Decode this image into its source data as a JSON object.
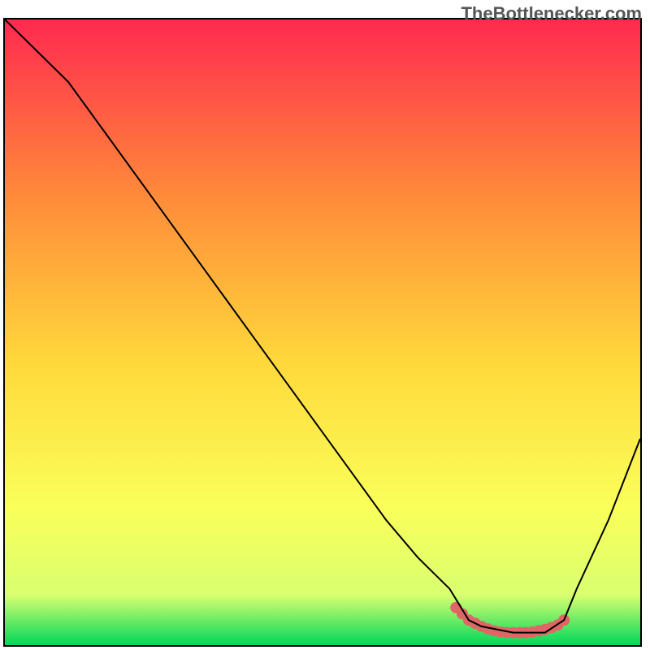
{
  "watermark": "TheBottlenecker.com",
  "chart_data": {
    "type": "line",
    "title": "",
    "xlabel": "",
    "ylabel": "",
    "xlim": [
      0,
      100
    ],
    "ylim": [
      0,
      100
    ],
    "grid": false,
    "legend": false,
    "series": [
      {
        "name": "main-curve",
        "color": "#000000",
        "x": [
          0,
          5,
          10,
          15,
          20,
          25,
          30,
          35,
          40,
          45,
          50,
          55,
          60,
          65,
          70,
          73,
          75,
          80,
          85,
          88,
          90,
          95,
          100
        ],
        "y": [
          100,
          95,
          90,
          83,
          76,
          69,
          62,
          55,
          48,
          41,
          34,
          27,
          20,
          14,
          9,
          4,
          3,
          2,
          2,
          4,
          9,
          20,
          33
        ]
      },
      {
        "name": "highlight-dots",
        "color": "#e06666",
        "kind": "scatter",
        "x": [
          71,
          72,
          73,
          74,
          75,
          76,
          77,
          78,
          79,
          80,
          81,
          82,
          83,
          84,
          85,
          86,
          87,
          88
        ],
        "y": [
          6,
          5,
          4,
          3.5,
          3,
          2.6,
          2.3,
          2.1,
          2.0,
          2.0,
          2.0,
          2.0,
          2.1,
          2.3,
          2.5,
          2.8,
          3.2,
          4
        ]
      }
    ],
    "background_gradient": {
      "top_color": "#ff2a4f",
      "upper_mid_color": "#ff8a3a",
      "mid_color": "#ffd93b",
      "lower_mid_color": "#faff5a",
      "near_bottom": "#d9ff70",
      "bottom_color": "#00d85a"
    }
  }
}
